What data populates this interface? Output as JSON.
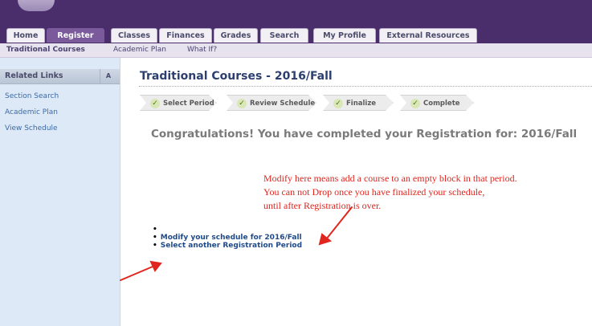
{
  "nav": {
    "tabs": [
      {
        "label": "Home"
      },
      {
        "label": "Register",
        "active": true
      },
      {
        "label": "Classes"
      },
      {
        "label": "Finances"
      },
      {
        "label": "Grades"
      },
      {
        "label": "Search"
      },
      {
        "label": "My Profile"
      },
      {
        "label": "External Resources"
      }
    ],
    "subnav": [
      "Traditional Courses",
      "Academic Plan",
      "What If?"
    ]
  },
  "sidebar": {
    "header": "Related Links",
    "collapse_symbol": "A",
    "links": [
      "Section Search",
      "Academic Plan",
      "View Schedule"
    ]
  },
  "main": {
    "title": "Traditional Courses - 2016/Fall",
    "steps": [
      "Select Period",
      "Review Schedule",
      "Finalize",
      "Complete"
    ],
    "congrats": "Congratulations! You have completed your Registration for: 2016/Fall",
    "links": [
      "Modify your schedule for 2016/Fall",
      "Select another Registration Period"
    ]
  },
  "annotation": {
    "lines": [
      "Modify here means add a course to an empty block in that period.",
      "You can not Drop once you have finalized your schedule,",
      "until after Registration is over."
    ],
    "color": "#e0261e"
  },
  "colors": {
    "brand": "#4a2e6b",
    "active_tab": "#7a5a9b",
    "link": "#1f4a8a"
  }
}
